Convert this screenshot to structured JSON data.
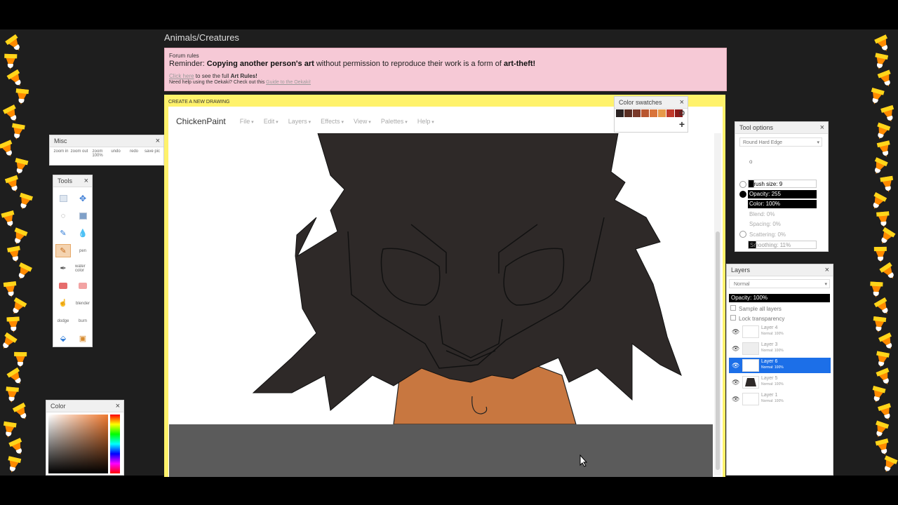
{
  "breadcrumb": "Animals/Creatures",
  "rules_box": {
    "title": "Forum rules",
    "reminder_prefix": "Reminder: ",
    "reminder_bold": "Copying another person's art",
    "reminder_mid": " without permission to reproduce their work is a form of ",
    "reminder_bold2": "art-theft!",
    "line1_link": "Click here",
    "line1_text": " to see the full ",
    "line1_bold": "Art Rules!",
    "line2_text": "Need help using the Oekaki? Check out this ",
    "line2_link": "Guide to the Oekaki!"
  },
  "drawing_header": "CREATE A NEW DRAWING",
  "app": {
    "brand": "ChickenPaint",
    "menus": [
      "File",
      "Edit",
      "Layers",
      "Effects",
      "View",
      "Palettes",
      "Help"
    ]
  },
  "panels": {
    "misc": {
      "title": "Misc",
      "items": [
        "zoom in",
        "zoom out",
        "zoom 100%",
        "undo",
        "redo",
        "save pic"
      ]
    },
    "tools": {
      "title": "Tools",
      "labels": [
        "pen",
        "water color",
        "blender",
        "dodge",
        "burn"
      ]
    },
    "color": {
      "title": "Color"
    },
    "color_swatches": {
      "title": "Color swatches",
      "swatches": [
        "#2b2323",
        "#5a2e23",
        "#7a3a2a",
        "#b8562f",
        "#d9743a",
        "#e79a4a",
        "#c0392b",
        "#8b1a1a"
      ]
    },
    "tool_options": {
      "title": "Tool options",
      "brush_select": "Round Hard Edge",
      "rows": [
        {
          "label": "Brush size: 9",
          "fill": 0.08
        },
        {
          "label": "Opacity: 255",
          "fill": 1.0
        },
        {
          "label": "Color: 100%",
          "fill": 1.0
        },
        {
          "label": "Blend: 0%",
          "fill": 0
        },
        {
          "label": "Spacing: 0%",
          "fill": 0
        },
        {
          "label": "Scattering: 0%",
          "fill": 0
        },
        {
          "label": "Smoothing: 11%",
          "fill": 0.11
        }
      ]
    },
    "layers": {
      "title": "Layers",
      "blend_mode": "Normal",
      "opacity": "Opacity: 100%",
      "sample_all": "Sample all layers",
      "lock_transparency": "Lock transparency",
      "items": [
        {
          "name": "Layer 4",
          "mode": "Normal: 100%"
        },
        {
          "name": "Layer 3",
          "mode": "Normal: 100%"
        },
        {
          "name": "Layer 6",
          "mode": "Normal: 100%"
        },
        {
          "name": "Layer 5",
          "mode": "Normal: 100%"
        },
        {
          "name": "Layer 1",
          "mode": "Normal: 100%"
        }
      ]
    }
  },
  "colors": {
    "fur": "#2e2928",
    "skin": "#c87740",
    "accent_selection": "#1c6fe8"
  }
}
